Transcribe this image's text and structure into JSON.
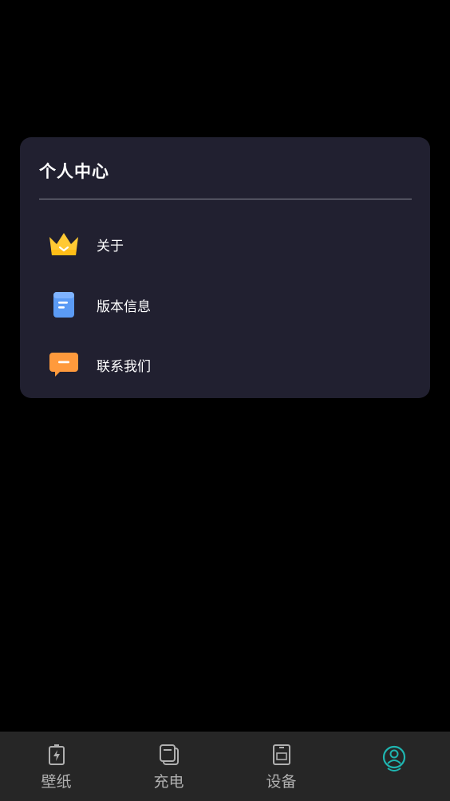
{
  "card": {
    "title": "个人中心",
    "items": [
      {
        "label": "关于",
        "icon": "crown-icon"
      },
      {
        "label": "版本信息",
        "icon": "document-icon"
      },
      {
        "label": "联系我们",
        "icon": "chat-bubble-icon"
      }
    ]
  },
  "tabbar": {
    "tabs": [
      {
        "label": "壁纸",
        "icon": "battery-bolt-icon",
        "active": false
      },
      {
        "label": "充电",
        "icon": "layers-icon",
        "active": false
      },
      {
        "label": "设备",
        "icon": "device-icon",
        "active": false
      },
      {
        "label": "",
        "icon": "profile-icon",
        "active": true
      }
    ]
  },
  "colors": {
    "background": "#000000",
    "card": "#212030",
    "tabbar": "#262626",
    "accent": "#1fb5b0",
    "crown": "#ffc933",
    "document": "#5b9bf5",
    "chat": "#ff9a3c"
  }
}
